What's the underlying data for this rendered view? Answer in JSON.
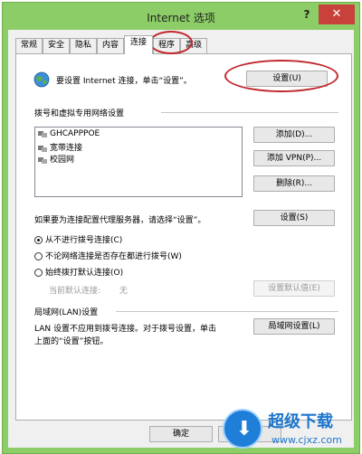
{
  "window": {
    "title": "Internet 选项",
    "help": "?",
    "close": "✕"
  },
  "tabs": [
    {
      "label": "常规"
    },
    {
      "label": "安全"
    },
    {
      "label": "隐私"
    },
    {
      "label": "内容"
    },
    {
      "label": "连接"
    },
    {
      "label": "程序"
    },
    {
      "label": "高级"
    }
  ],
  "active_tab": "连接",
  "setup": {
    "text": "要设置 Internet 连接，单击“设置”。",
    "button": "设置(U)"
  },
  "dialup": {
    "heading": "拨号和虚拟专用网络设置",
    "connections": [
      "GHCAPPPOE",
      "宽带连接",
      "校园网"
    ],
    "add": "添加(D)...",
    "add_vpn": "添加 VPN(P)...",
    "remove": "删除(R)...",
    "proxy_text": "如果要为连接配置代理服务器，请选择“设置”。",
    "settings": "设置(S)",
    "options": [
      {
        "label": "从不进行拨号连接(C)",
        "selected": true
      },
      {
        "label": "不论网络连接是否存在都进行拨号(W)",
        "selected": false
      },
      {
        "label": "始终拨打默认连接(O)",
        "selected": false
      }
    ],
    "current_default_label": "当前默认连接:",
    "current_default_value": "无",
    "set_default": "设置默认值(E)"
  },
  "lan": {
    "heading": "局域网(LAN)设置",
    "text_line1": "LAN 设置不应用到拨号连接。对于拨号设置，单击",
    "text_line2": "上面的“设置”按钮。",
    "button": "局域网设置(L)"
  },
  "footer": {
    "ok": "确定",
    "cancel": "取消"
  },
  "watermark": {
    "title": "超级下载",
    "url": "www.cjxz.com"
  },
  "colors": {
    "frame": "#8ccd67",
    "close": "#c8413a",
    "annotation": "#c0282d",
    "watermark": "#1d76cc"
  }
}
